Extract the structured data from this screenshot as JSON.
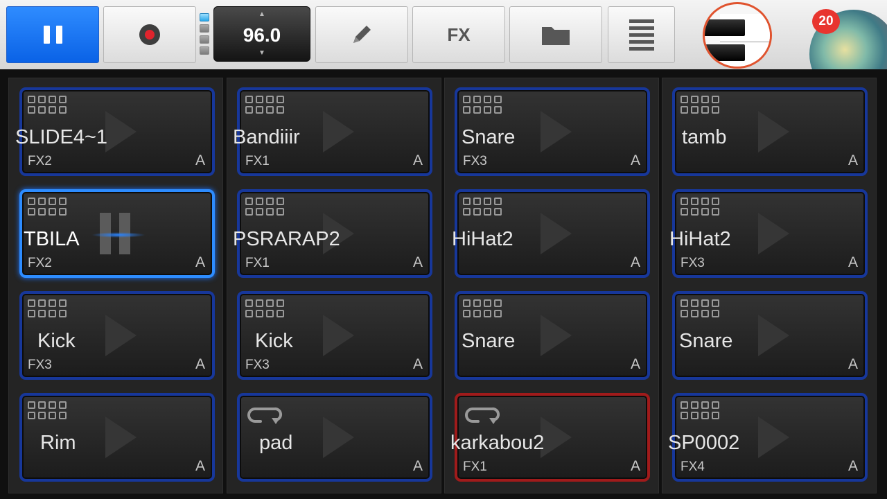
{
  "toolbar": {
    "tempo": "96.0",
    "fx_label": "FX",
    "notification_count": "20"
  },
  "pads": [
    {
      "name": "SLIDE4~1",
      "fx": "FX2",
      "mode": "A",
      "icon": "grid-icon",
      "state": "idle"
    },
    {
      "name": "TBILA",
      "fx": "FX2",
      "mode": "A",
      "icon": "grid-icon",
      "state": "playing"
    },
    {
      "name": "Kick",
      "fx": "FX3",
      "mode": "A",
      "icon": "grid-icon",
      "state": "idle"
    },
    {
      "name": "Rim",
      "fx": "",
      "mode": "A",
      "icon": "grid-icon",
      "state": "idle"
    },
    {
      "name": "Bandiiir",
      "fx": "FX1",
      "mode": "A",
      "icon": "grid-icon",
      "state": "idle"
    },
    {
      "name": "PSRARAP2",
      "fx": "FX1",
      "mode": "A",
      "icon": "grid-icon",
      "state": "idle"
    },
    {
      "name": "Kick",
      "fx": "FX3",
      "mode": "A",
      "icon": "grid-icon",
      "state": "idle"
    },
    {
      "name": "pad",
      "fx": "",
      "mode": "A",
      "icon": "loop-icon",
      "state": "idle"
    },
    {
      "name": "Snare",
      "fx": "FX3",
      "mode": "A",
      "icon": "grid-icon",
      "state": "idle"
    },
    {
      "name": "HiHat2",
      "fx": "",
      "mode": "A",
      "icon": "grid-icon",
      "state": "idle"
    },
    {
      "name": "Snare",
      "fx": "",
      "mode": "A",
      "icon": "grid-icon",
      "state": "idle"
    },
    {
      "name": "karkabou2",
      "fx": "FX1",
      "mode": "A",
      "icon": "loop-icon",
      "state": "loop-red"
    },
    {
      "name": "tamb",
      "fx": "",
      "mode": "A",
      "icon": "grid-icon",
      "state": "idle"
    },
    {
      "name": "HiHat2",
      "fx": "FX3",
      "mode": "A",
      "icon": "grid-icon",
      "state": "idle"
    },
    {
      "name": "Snare",
      "fx": "",
      "mode": "A",
      "icon": "grid-icon",
      "state": "idle"
    },
    {
      "name": "SP0002",
      "fx": "FX4",
      "mode": "A",
      "icon": "grid-icon",
      "state": "idle"
    }
  ],
  "colors": {
    "accent_blue": "#0a62e6",
    "pad_border": "#17379a",
    "pad_active_border": "#2d8cff",
    "loop_active_border": "#a01b1b",
    "record_red": "#e0242d",
    "badge_red": "#e8352f"
  }
}
